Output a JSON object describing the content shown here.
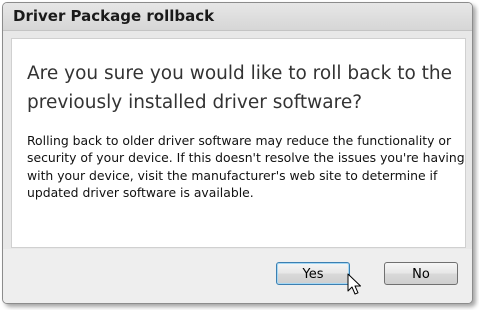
{
  "dialog": {
    "title": "Driver Package rollback",
    "heading": "Are you sure you would like to roll back to the previously installed driver software?",
    "body": "Rolling back to older driver software may reduce the functionality or security of your device. If this doesn't resolve the issues you're having with your device, visit the manufacturer's web site to determine if updated driver software is available.",
    "yes_label": "Yes",
    "no_label": "No"
  },
  "cursor": {
    "icon": "arrow-cursor-icon"
  }
}
